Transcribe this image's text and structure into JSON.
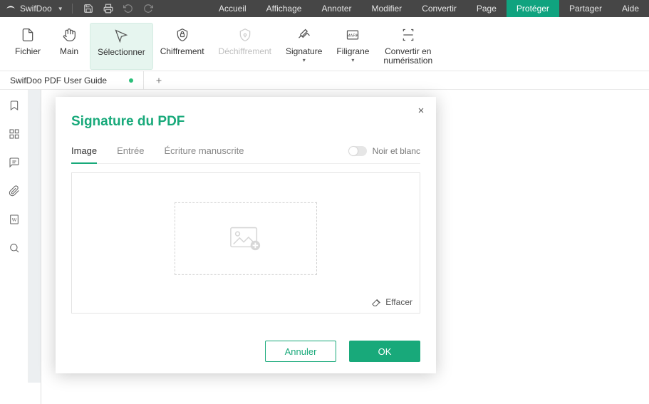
{
  "brand": {
    "name": "SwifDoo"
  },
  "menu": {
    "items": [
      {
        "label": "Accueil"
      },
      {
        "label": "Affichage"
      },
      {
        "label": "Annoter"
      },
      {
        "label": "Modifier"
      },
      {
        "label": "Convertir"
      },
      {
        "label": "Page"
      },
      {
        "label": "Protéger",
        "active": true
      },
      {
        "label": "Partager"
      },
      {
        "label": "Aide"
      }
    ]
  },
  "ribbon": {
    "file": "Fichier",
    "hand": "Main",
    "select": "Sélectionner",
    "encrypt": "Chiffrement",
    "decrypt": "Déchiffrement",
    "signature": "Signature",
    "watermark": "Filigrane",
    "convert_scan": "Convertir en\nnumérisation"
  },
  "tabs": {
    "items": [
      {
        "title": "SwifDoo PDF User Guide",
        "modified": true
      }
    ]
  },
  "dialog": {
    "title": "Signature du PDF",
    "tabs": {
      "image": "Image",
      "input": "Entrée",
      "handwrite": "Écriture manuscrite"
    },
    "bw_label": "Noir et blanc",
    "erase": "Effacer",
    "cancel": "Annuler",
    "ok": "OK"
  }
}
